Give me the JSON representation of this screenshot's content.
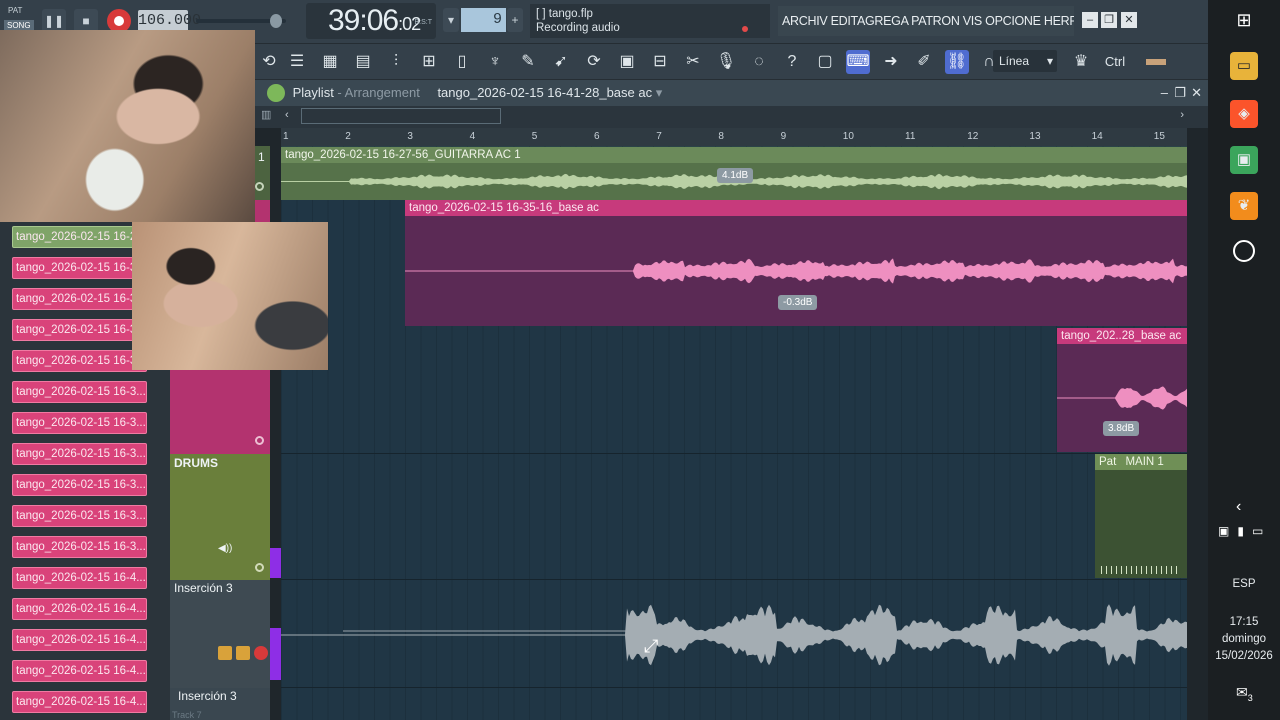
{
  "transport": {
    "pat_label": "PAT",
    "song_label": "SONG",
    "tempo": "106.000",
    "time_main": "39:06",
    "time_sub": ":02",
    "time_unit": "B:S:T",
    "pattern_number": "9"
  },
  "hint": {
    "line1": "[   ] tango.flp",
    "line2": "Recording audio"
  },
  "menu": {
    "text": "ARCHIV EDITAGREGA PATRON VIS OPCIONE HERRAMIENTA"
  },
  "toolbar": {
    "snap_value": "Línea",
    "ctrl_label": "Ctrl"
  },
  "playlist": {
    "title": "Playlist",
    "separator": " - ",
    "mode": "Arrangement",
    "pattern": "tango_2026-02-15 16-41-28_base ac"
  },
  "ruler": [
    "1",
    "2",
    "3",
    "4",
    "5",
    "6",
    "7",
    "8",
    "9",
    "10",
    "11",
    "12",
    "13",
    "14",
    "15"
  ],
  "tracks": {
    "track1_num": "1",
    "drums_label": "DRUMS",
    "insercion_label": "Inserción 3",
    "insercion2_label": "Inserción 3",
    "track7_label": "Track 7"
  },
  "regions": {
    "guitar": {
      "title": "tango_2026-02-15 16-27-56_GUITARRA AC 1",
      "db": "4.1dB",
      "color": "#7fa468"
    },
    "base1": {
      "title": "tango_2026-02-15 16-35-16_base ac",
      "db": "-0.3dB",
      "color": "#d6468a"
    },
    "base2": {
      "title": "tango_202..28_base ac",
      "db": "3.8dB",
      "color": "#d6468a"
    },
    "pattern": {
      "title": "Pat",
      "title2": "MAIN 1",
      "color": "#8aa96a"
    }
  },
  "browser_clips": [
    "tango_2026-02-15 16-2",
    "tango_2026-02-15 16-3",
    "tango_2026-02-15 16-3",
    "tango_2026-02-15 16-3",
    "tango_2026-02-15 16-3",
    "tango_2026-02-15 16-3...",
    "tango_2026-02-15 16-3...",
    "tango_2026-02-15 16-3...",
    "tango_2026-02-15 16-3...",
    "tango_2026-02-15 16-3...",
    "tango_2026-02-15 16-3...",
    "tango_2026-02-15 16-4...",
    "tango_2026-02-15 16-4...",
    "tango_2026-02-15 16-4...",
    "tango_2026-02-15 16-4...",
    "tango_2026-02-15 16-4..."
  ],
  "taskbar": {
    "lang": "ESP",
    "time": "17:15",
    "day": "domingo",
    "date": "15/02/2026",
    "notif_count": "3"
  }
}
